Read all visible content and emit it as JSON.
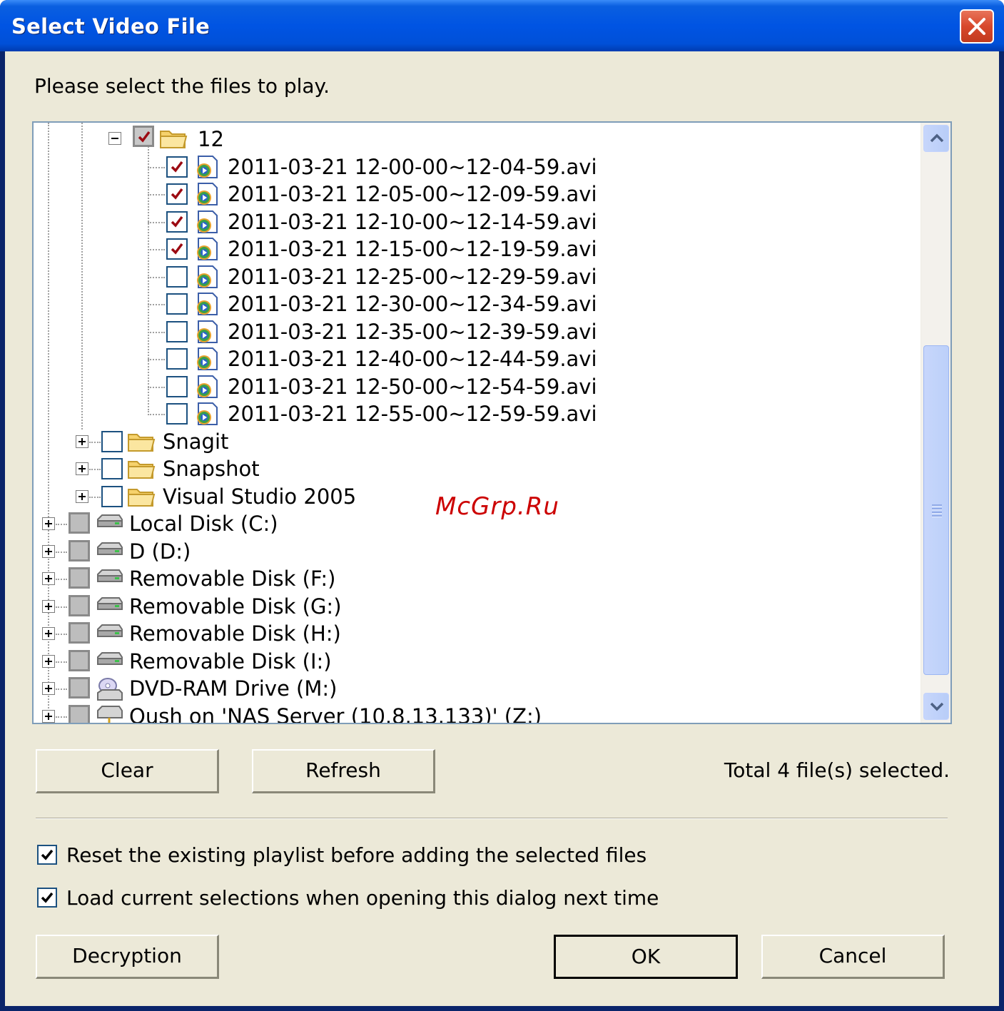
{
  "window": {
    "title": "Select Video File"
  },
  "prompt": "Please select the files to play.",
  "tree": {
    "folder_12": {
      "label": "12",
      "state": "mixed"
    },
    "files": [
      {
        "name": "2011-03-21 12-00-00~12-04-59.avi",
        "checked": true
      },
      {
        "name": "2011-03-21 12-05-00~12-09-59.avi",
        "checked": true
      },
      {
        "name": "2011-03-21 12-10-00~12-14-59.avi",
        "checked": true
      },
      {
        "name": "2011-03-21 12-15-00~12-19-59.avi",
        "checked": true
      },
      {
        "name": "2011-03-21 12-25-00~12-29-59.avi",
        "checked": false
      },
      {
        "name": "2011-03-21 12-30-00~12-34-59.avi",
        "checked": false
      },
      {
        "name": "2011-03-21 12-35-00~12-39-59.avi",
        "checked": false
      },
      {
        "name": "2011-03-21 12-40-00~12-44-59.avi",
        "checked": false
      },
      {
        "name": "2011-03-21 12-50-00~12-54-59.avi",
        "checked": false
      },
      {
        "name": "2011-03-21 12-55-00~12-59-59.avi",
        "checked": false
      }
    ],
    "folders": [
      {
        "name": "Snagit"
      },
      {
        "name": "Snapshot"
      },
      {
        "name": "Visual Studio 2005"
      }
    ],
    "drives": [
      {
        "name": "Local Disk (C:)",
        "icon": "hard-disk-icon"
      },
      {
        "name": "D (D:)",
        "icon": "hard-disk-icon"
      },
      {
        "name": "Removable Disk (F:)",
        "icon": "removable-disk-icon"
      },
      {
        "name": "Removable Disk (G:)",
        "icon": "removable-disk-icon"
      },
      {
        "name": "Removable Disk (H:)",
        "icon": "removable-disk-icon"
      },
      {
        "name": "Removable Disk (I:)",
        "icon": "removable-disk-icon"
      },
      {
        "name": "DVD-RAM Drive (M:)",
        "icon": "dvd-drive-icon"
      },
      {
        "name": "Qush on 'NAS Server (10.8.13.133)' (Z:)",
        "icon": "network-drive-icon"
      }
    ]
  },
  "buttons": {
    "clear": "Clear",
    "refresh": "Refresh",
    "decryption": "Decryption",
    "ok": "OK",
    "cancel": "Cancel"
  },
  "status": "Total 4 file(s) selected.",
  "options": {
    "reset_playlist": {
      "label": "Reset the existing playlist before adding the selected files",
      "checked": true
    },
    "load_selections": {
      "label": "Load current selections when opening this dialog next time",
      "checked": true
    }
  },
  "watermark": "McGrp.Ru",
  "colors": {
    "title_bar": "#0054e3",
    "dialog_bg": "#ece9d8",
    "tree_border": "#7f9db9",
    "check_red": "#9c0a12",
    "check_black": "#000000"
  }
}
